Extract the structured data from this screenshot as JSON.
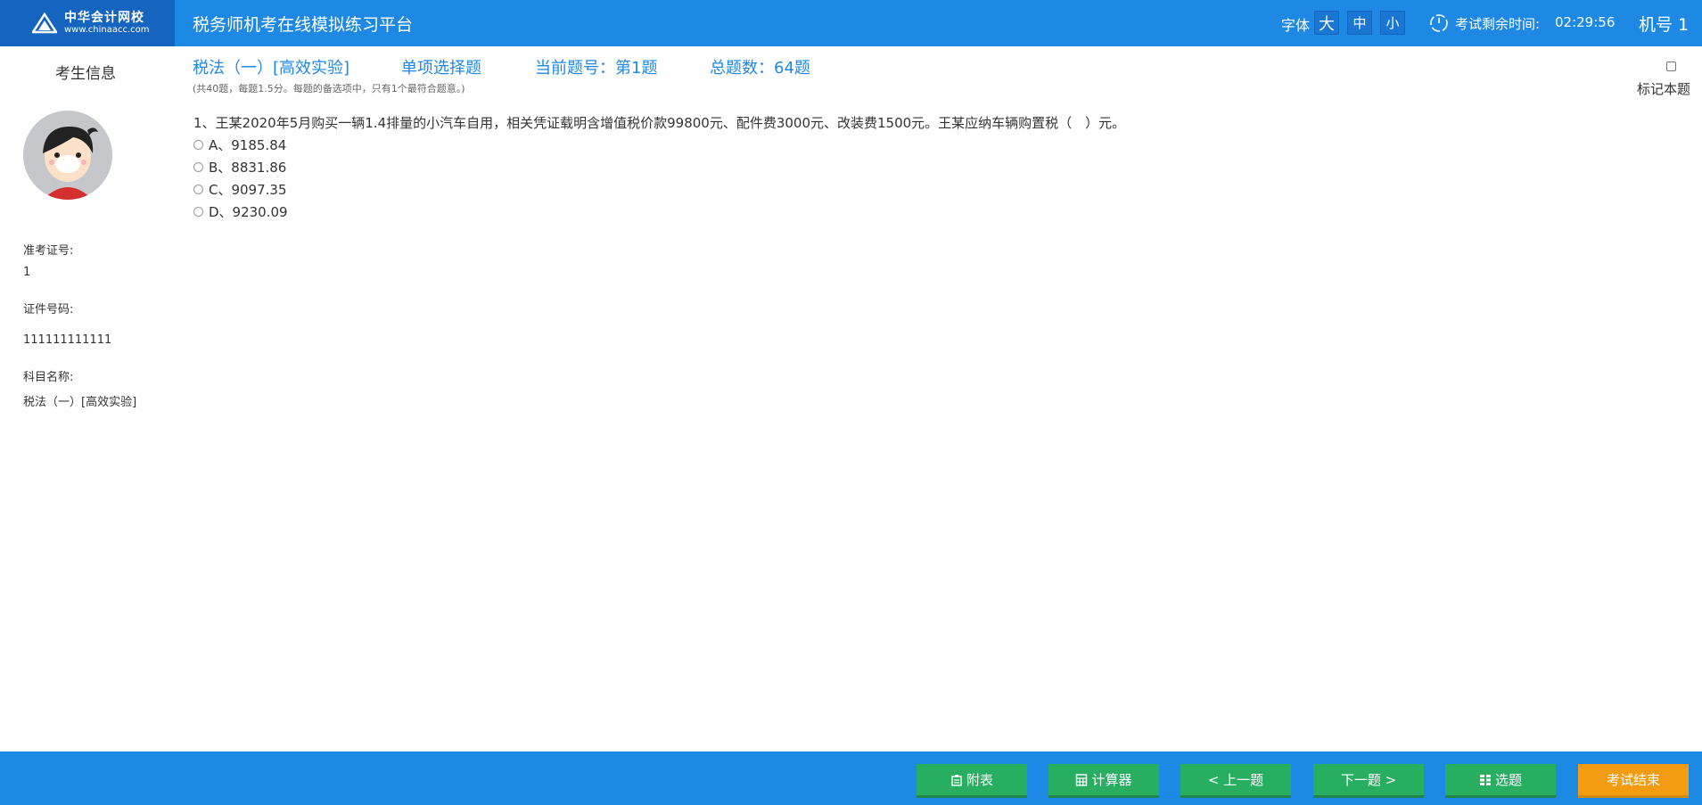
{
  "header": {
    "logo_cn": "中华会计网校",
    "logo_en": "www.chinaacc.com",
    "title": "税务师机考在线模拟练习平台",
    "font_label": "字体",
    "font_large": "大",
    "font_medium": "中",
    "font_small": "小",
    "timer_label": "考试剩余时间:",
    "timer_value": "02:29:56",
    "machine_no": "机号 1"
  },
  "sidebar": {
    "title": "考生信息",
    "ticket_label": "准考证号:",
    "ticket_value": "1",
    "id_label": "证件号码:",
    "id_value": "111111111111",
    "subject_label": "科目名称:",
    "subject_value": "税法（一）[高效实验]"
  },
  "question_header": {
    "subject": "税法（一）[高效实验]",
    "type": "单项选择题",
    "current": "当前题号：第1题",
    "total": "总题数：64题",
    "note": "(共40题，每题1.5分。每题的备选项中，只有1个最符合题意。)",
    "mark_label": "标记本题"
  },
  "question": {
    "text": "1、王某2020年5月购买一辆1.4排量的小汽车自用，相关凭证载明含增值税价款99800元、配件费3000元、改装费1500元。王某应纳车辆购置税（　）元。",
    "options": [
      "A、9185.84",
      "B、8831.86",
      "C、9097.35",
      "D、9230.09"
    ]
  },
  "footer": {
    "appendix": "附表",
    "calculator": "计算器",
    "prev": "< 上一题",
    "next": "下一题 >",
    "select": "选题",
    "end": "考试结束"
  },
  "colors": {
    "primary": "#1e88e5",
    "logo_bg": "#1565c0",
    "green": "#27ae60",
    "orange": "#f39c12"
  }
}
